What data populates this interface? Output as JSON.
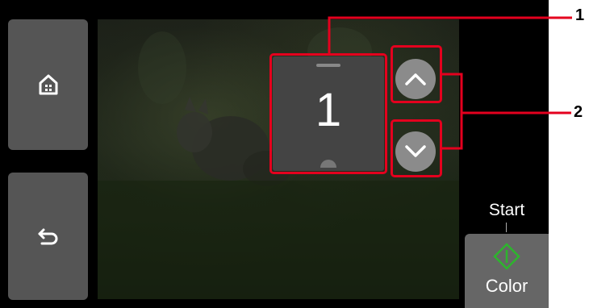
{
  "counter": {
    "value": "1"
  },
  "start": {
    "label": "Start",
    "button_label": "Color"
  },
  "callouts": {
    "one": "1",
    "two": "2"
  },
  "icons": {
    "home": "home-icon",
    "back": "back-arrow-icon",
    "up": "chevron-up-icon",
    "down": "chevron-down-icon",
    "start": "start-diamond-icon"
  },
  "colors": {
    "highlight": "#e4001e",
    "start_accent": "#2db52d"
  }
}
